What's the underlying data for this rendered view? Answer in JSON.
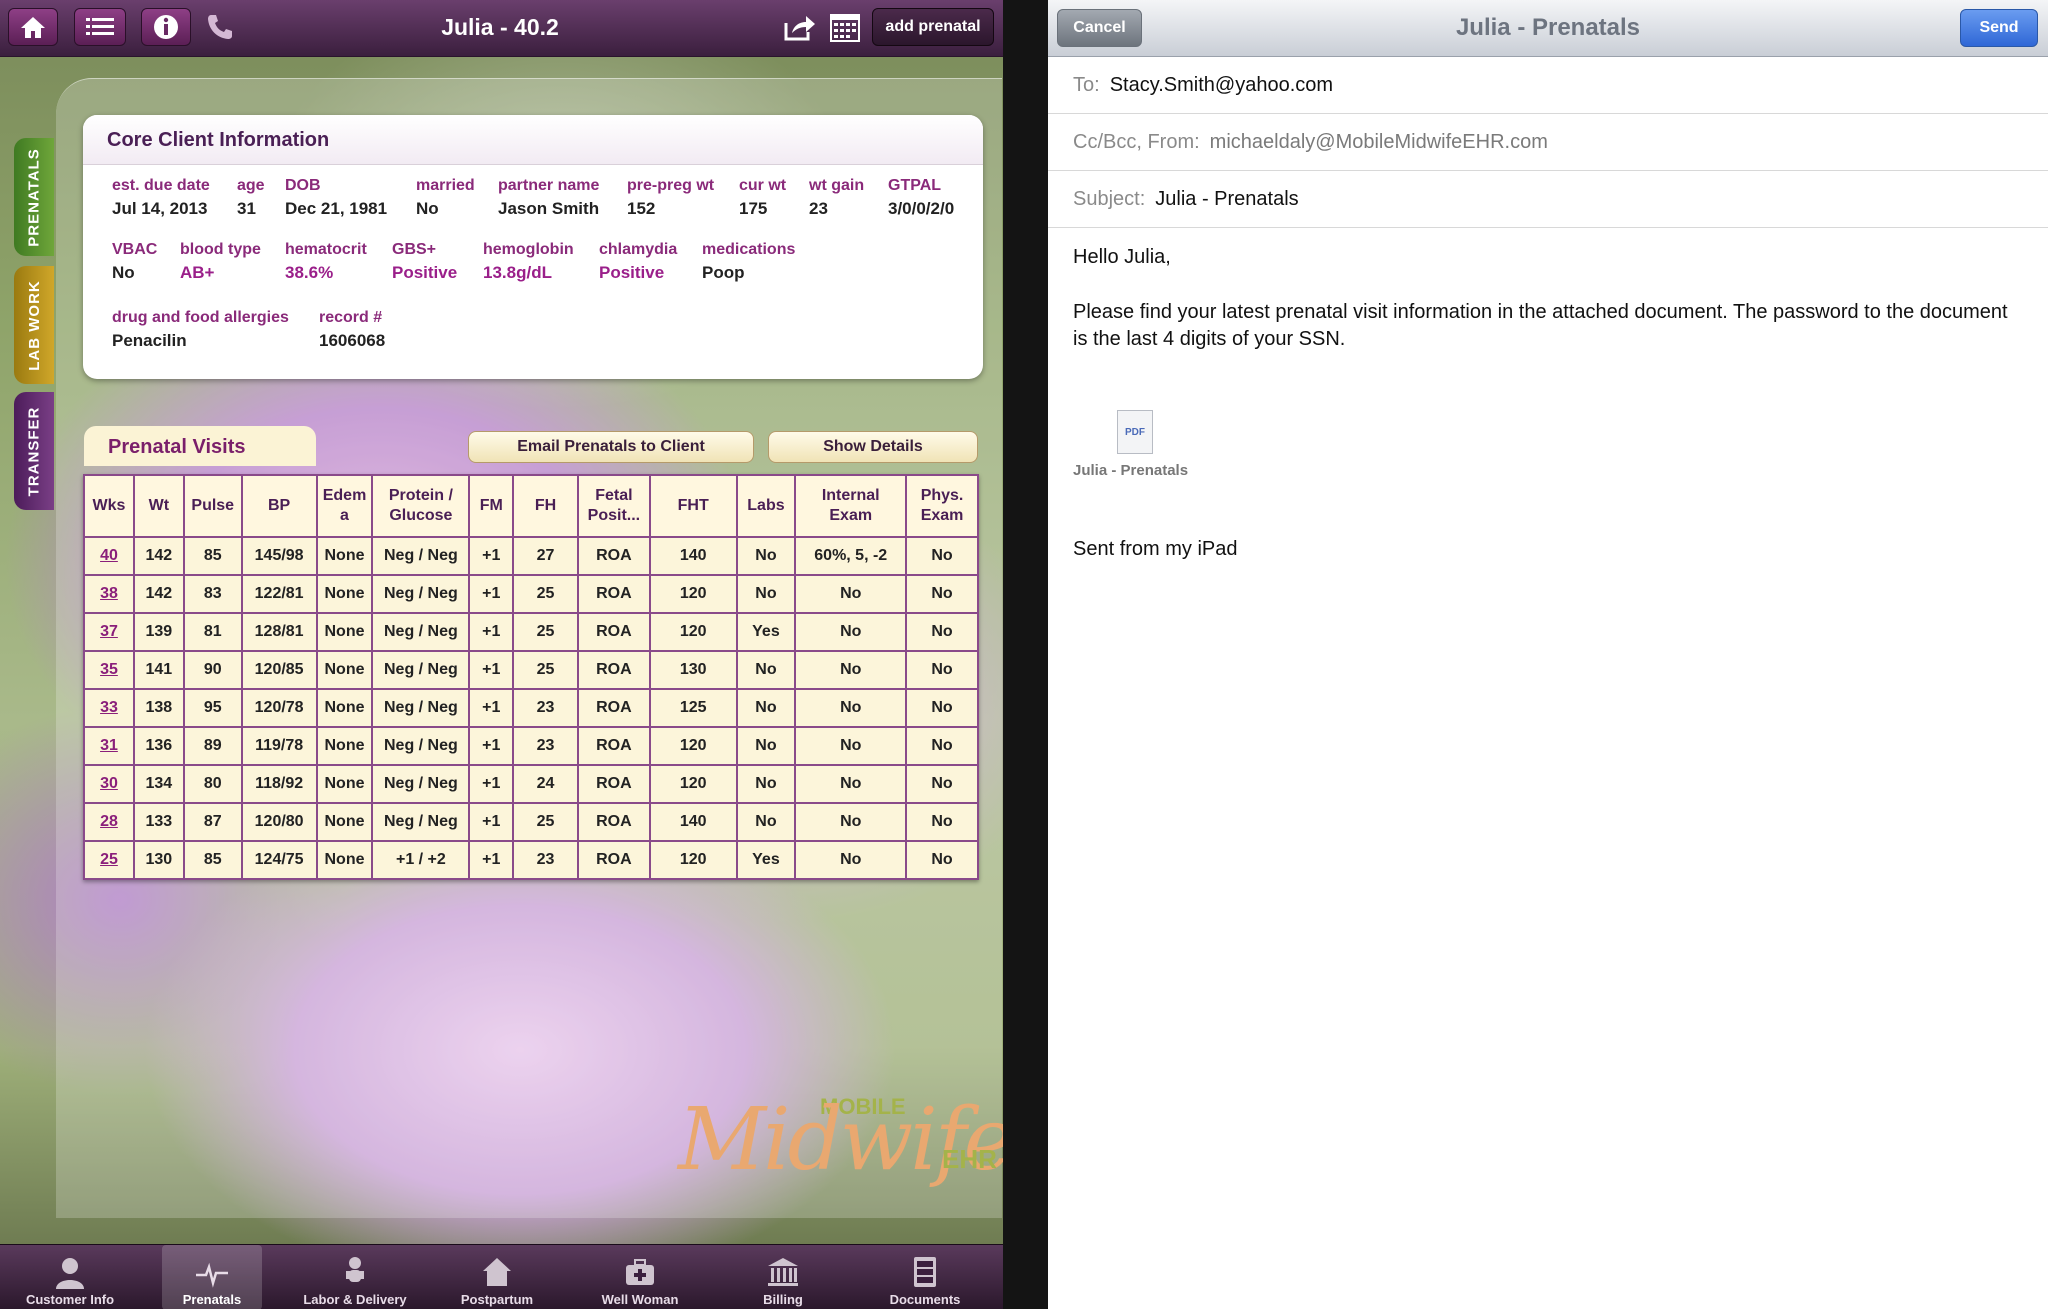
{
  "app": {
    "title": "Julia - 40.2",
    "add_prenatal_label": "add prenatal",
    "side_tabs": [
      "PRENATALS",
      "LAB WORK",
      "TRANSFER"
    ],
    "core": {
      "heading": "Core Client Information",
      "fields": {
        "due_date": {
          "label": "est. due date",
          "value": "Jul 14, 2013"
        },
        "age": {
          "label": "age",
          "value": "31"
        },
        "dob": {
          "label": "DOB",
          "value": "Dec 21, 1981"
        },
        "married": {
          "label": "married",
          "value": "No"
        },
        "partner": {
          "label": "partner name",
          "value": "Jason Smith"
        },
        "preg_wt": {
          "label": "pre-preg wt",
          "value": "152"
        },
        "cur_wt": {
          "label": "cur wt",
          "value": "175"
        },
        "wt_gain": {
          "label": "wt gain",
          "value": "23"
        },
        "gtpal": {
          "label": "GTPAL",
          "value": "3/0/0/2/0"
        },
        "vbac": {
          "label": "VBAC",
          "value": "No"
        },
        "blood": {
          "label": "blood type",
          "value": "AB+"
        },
        "hematocrit": {
          "label": "hematocrit",
          "value": "38.6%"
        },
        "gbs": {
          "label": "GBS+",
          "value": "Positive"
        },
        "hemoglobin": {
          "label": "hemoglobin",
          "value": "13.8g/dL"
        },
        "chlamydia": {
          "label": "chlamydia",
          "value": "Positive"
        },
        "medications": {
          "label": "medications",
          "value": "Poop"
        },
        "allergies": {
          "label": "drug and food allergies",
          "value": "Penacilin"
        },
        "record": {
          "label": "record #",
          "value": "1606068"
        }
      }
    },
    "visits": {
      "tab_label": "Prenatal Visits",
      "email_button": "Email Prenatals to Client",
      "details_button": "Show Details",
      "columns": [
        "Wks",
        "Wt",
        "Pulse",
        "BP",
        "Edem a",
        "Protein / Glucose",
        "FM",
        "FH",
        "Fetal Posit...",
        "FHT",
        "Labs",
        "Internal Exam",
        "Phys. Exam"
      ],
      "rows": [
        [
          "40",
          "142",
          "85",
          "145/98",
          "None",
          "Neg / Neg",
          "+1",
          "27",
          "ROA",
          "140",
          "No",
          "60%, 5, -2",
          "No"
        ],
        [
          "38",
          "142",
          "83",
          "122/81",
          "None",
          "Neg / Neg",
          "+1",
          "25",
          "ROA",
          "120",
          "No",
          "No",
          "No"
        ],
        [
          "37",
          "139",
          "81",
          "128/81",
          "None",
          "Neg / Neg",
          "+1",
          "25",
          "ROA",
          "120",
          "Yes",
          "No",
          "No"
        ],
        [
          "35",
          "141",
          "90",
          "120/85",
          "None",
          "Neg / Neg",
          "+1",
          "25",
          "ROA",
          "130",
          "No",
          "No",
          "No"
        ],
        [
          "33",
          "138",
          "95",
          "120/78",
          "None",
          "Neg / Neg",
          "+1",
          "23",
          "ROA",
          "125",
          "No",
          "No",
          "No"
        ],
        [
          "31",
          "136",
          "89",
          "119/78",
          "None",
          "Neg / Neg",
          "+1",
          "23",
          "ROA",
          "120",
          "No",
          "No",
          "No"
        ],
        [
          "30",
          "134",
          "80",
          "118/92",
          "None",
          "Neg / Neg",
          "+1",
          "24",
          "ROA",
          "120",
          "No",
          "No",
          "No"
        ],
        [
          "28",
          "133",
          "87",
          "120/80",
          "None",
          "Neg / Neg",
          "+1",
          "25",
          "ROA",
          "140",
          "No",
          "No",
          "No"
        ],
        [
          "25",
          "130",
          "85",
          "124/75",
          "None",
          "+1 / +2",
          "+1",
          "23",
          "ROA",
          "120",
          "Yes",
          "No",
          "No"
        ]
      ]
    },
    "logo": {
      "mobile": "MOBILE",
      "mid": "Midwife",
      "ehr": "EHR"
    },
    "bottom_nav": [
      {
        "label": "Customer Info",
        "icon": "person-icon"
      },
      {
        "label": "Prenatals",
        "icon": "heartbeat-icon"
      },
      {
        "label": "Labor & Delivery",
        "icon": "baby-icon"
      },
      {
        "label": "Postpartum",
        "icon": "house-icon"
      },
      {
        "label": "Well Woman",
        "icon": "medkit-icon"
      },
      {
        "label": "Billing",
        "icon": "bank-icon"
      },
      {
        "label": "Documents",
        "icon": "cabinet-icon"
      }
    ],
    "active_nav": "Prenatals",
    "accent_color": "#7a1f6a"
  },
  "email": {
    "title": "Julia - Prenatals",
    "cancel_label": "Cancel",
    "send_label": "Send",
    "to_label": "To:",
    "to_value": "Stacy.Smith@yahoo.com",
    "cc_label": "Cc/Bcc, From:",
    "cc_value": "michaeldaly@MobileMidwifeEHR.com",
    "subject_label": "Subject:",
    "subject_value": "Julia - Prenatals",
    "greeting": "Hello Julia,",
    "body": "Please find your latest prenatal visit information in the attached document. The password to the document is the last 4 digits of your SSN.",
    "attachment_type": "PDF",
    "attachment_name": "Julia - Prenatals",
    "signature": "Sent from my iPad",
    "send_color": "#2f67d6"
  }
}
